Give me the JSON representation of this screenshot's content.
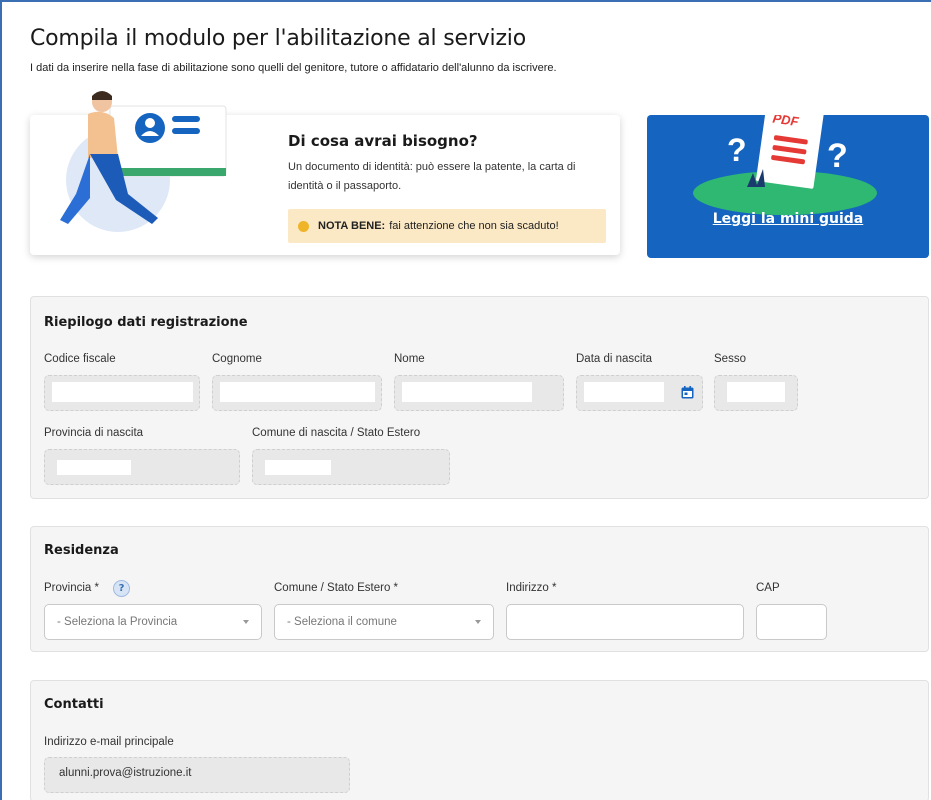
{
  "page": {
    "title": "Compila il modulo per l'abilitazione al servizio",
    "subtitle": "I dati da inserire nella fase di abilitazione sono quelli del genitore, tutore o affidatario dell'alunno da iscrivere."
  },
  "need_card": {
    "title": "Di cosa avrai bisogno?",
    "text": "Un documento di identità: può essere la patente, la carta di identità o il passaporto.",
    "nota_label": "NOTA BENE:",
    "nota_text": "fai attenzione che non sia scaduto!"
  },
  "guide_card": {
    "pdf_label": "PDF",
    "link": "Leggi la mini guida"
  },
  "riepilogo": {
    "title": "Riepilogo dati registrazione",
    "fields": {
      "codice_fiscale": "Codice fiscale",
      "cognome": "Cognome",
      "nome": "Nome",
      "data_nascita": "Data di nascita",
      "sesso": "Sesso",
      "provincia_nascita": "Provincia di nascita",
      "comune_nascita": "Comune di nascita / Stato Estero"
    }
  },
  "residenza": {
    "title": "Residenza",
    "provincia_label": "Provincia *",
    "provincia_placeholder": "- Seleziona la Provincia",
    "comune_label": "Comune / Stato Estero *",
    "comune_placeholder": "- Seleziona il comune",
    "indirizzo_label": "Indirizzo *",
    "cap_label": "CAP",
    "help_glyph": "?"
  },
  "contatti": {
    "title": "Contatti",
    "email_label": "Indirizzo e-mail principale",
    "email_value": "alunni.prova@istruzione.it"
  },
  "colors": {
    "accent": "#1565c0",
    "section_bg": "#f5f5f5",
    "nota_bg": "#fbe8c4",
    "nota_dot": "#f0b429"
  }
}
